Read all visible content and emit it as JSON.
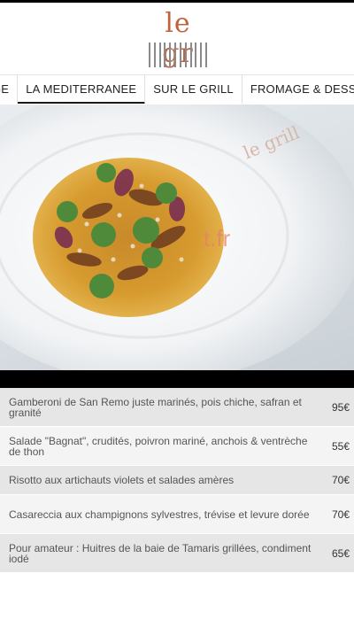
{
  "brand": {
    "logo_text": "le gr",
    "logo_accent": "#c0623e"
  },
  "nav": {
    "tabs": [
      {
        "label": "GE",
        "active": false
      },
      {
        "label": "LA MEDITERRANEE",
        "active": true
      },
      {
        "label": "SUR LE GRILL",
        "active": false
      },
      {
        "label": "FROMAGE & DESSERTS",
        "active": false
      }
    ]
  },
  "hero": {
    "image": "plated pasta dish with herbs on white plate",
    "watermark": "t.fr",
    "plate_logo": "le grill"
  },
  "menu": {
    "items": [
      {
        "dish": "Gamberoni de San Remo juste marinés, pois chiche, safran et granité",
        "price": "95€"
      },
      {
        "dish": "Salade \"Bagnat\", crudités, poivron mariné, anchois & ventrèche de thon",
        "price": "55€"
      },
      {
        "dish": "Risotto aux artichauts violets et salades amères",
        "price": "70€"
      },
      {
        "dish": "Casareccia aux champignons sylvestres, trévise et levure dorée",
        "price": "70€"
      },
      {
        "dish": "Pour amateur : Huitres de la baie de Tamaris grillées, condiment iodé",
        "price": "65€"
      }
    ]
  }
}
